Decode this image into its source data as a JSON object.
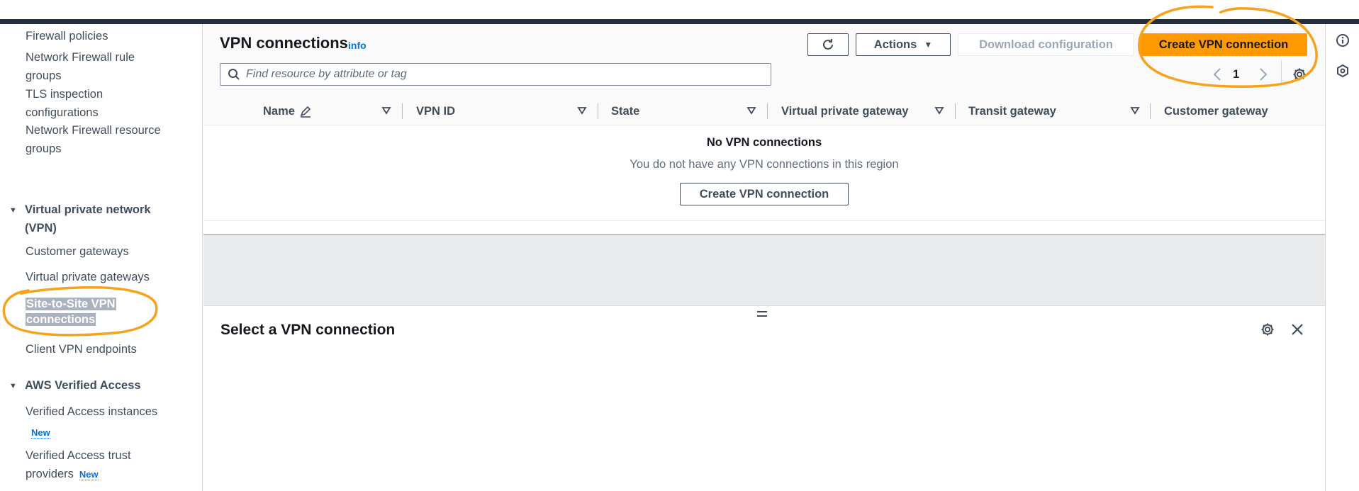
{
  "sidebar": {
    "links": [
      {
        "label": "Firewall policies"
      },
      {
        "label": "Network Firewall rule groups"
      },
      {
        "label": "TLS inspection configurations"
      },
      {
        "label": "Network Firewall resource groups"
      }
    ],
    "vpn_section": {
      "label": "Virtual private network (VPN)",
      "items": [
        {
          "label": "Customer gateways"
        },
        {
          "label": "Virtual private gateways"
        },
        {
          "label": "Site-to-Site VPN connections",
          "active": true
        },
        {
          "label": "Client VPN endpoints"
        }
      ]
    },
    "verified_section": {
      "label": "AWS Verified Access",
      "items": [
        {
          "label": "Verified Access instances",
          "badge": "New"
        },
        {
          "label": "Verified Access trust providers",
          "badge": "New"
        }
      ]
    }
  },
  "main": {
    "title": "VPN connections",
    "info_link": "info",
    "actions": {
      "actions_label": "Actions",
      "download_label": "Download configuration",
      "create_label": "Create VPN connection"
    },
    "search": {
      "placeholder": "Find resource by attribute or tag",
      "value": ""
    },
    "pagination": {
      "current_page": "1"
    },
    "table": {
      "columns": [
        "Name",
        "VPN ID",
        "State",
        "Virtual private gateway",
        "Transit gateway",
        "Customer gateway"
      ],
      "empty_title": "No VPN connections",
      "empty_message": "You do not have any VPN connections in this region",
      "empty_button": "Create VPN connection"
    },
    "split_panel": {
      "title": "Select a VPN connection"
    }
  },
  "colors": {
    "primary": "#ff9900",
    "link": "#0972d3",
    "annotation": "#f7a21b",
    "topbar": "#232f3e"
  },
  "icons": [
    "refresh-icon",
    "caret-down-icon",
    "search-icon",
    "chevron-left-icon",
    "chevron-right-icon",
    "settings-icon",
    "info-icon",
    "feedback-icon",
    "close-icon",
    "edit-icon",
    "sort-icon"
  ]
}
